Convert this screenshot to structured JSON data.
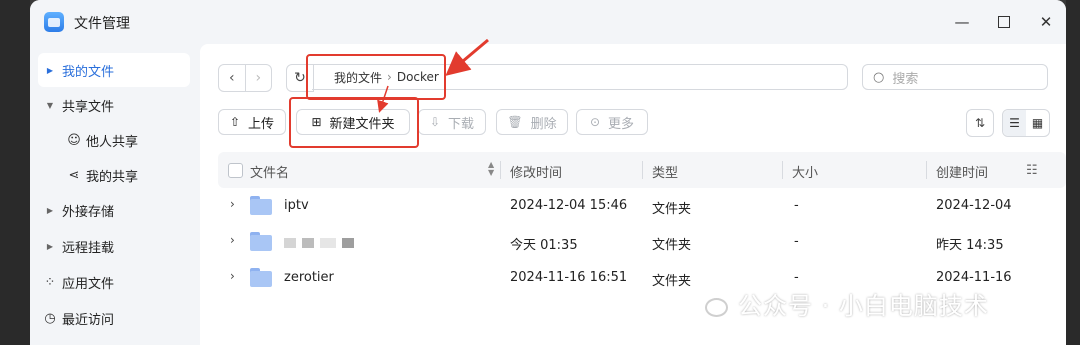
{
  "window": {
    "title": "文件管理"
  },
  "sidebar": {
    "items": [
      {
        "label": "我的文件",
        "active": true
      },
      {
        "label": "共享文件"
      },
      {
        "label": "他人共享"
      },
      {
        "label": "我的共享"
      },
      {
        "label": "外接存储"
      },
      {
        "label": "远程挂载"
      },
      {
        "label": "应用文件"
      },
      {
        "label": "最近访问"
      }
    ]
  },
  "path": {
    "root": "我的文件",
    "current": "Docker"
  },
  "search": {
    "placeholder": "搜索"
  },
  "toolbar": {
    "upload": "上传",
    "new_folder": "新建文件夹",
    "download": "下载",
    "delete": "删除",
    "more": "更多"
  },
  "table": {
    "headers": {
      "name": "文件名",
      "modified": "修改时间",
      "type": "类型",
      "size": "大小",
      "created": "创建时间"
    },
    "rows": [
      {
        "name": "iptv",
        "modified": "2024-12-04 15:46",
        "type": "文件夹",
        "size": "-",
        "created": "2024-12-04"
      },
      {
        "name": "",
        "modified": "今天 01:35",
        "type": "文件夹",
        "size": "-",
        "created": "昨天 14:35"
      },
      {
        "name": "zerotier",
        "modified": "2024-11-16 16:51",
        "type": "文件夹",
        "size": "-",
        "created": "2024-11-16"
      }
    ]
  },
  "watermark": "公众号 · 小白电脑技术",
  "colors": {
    "accent": "#2a6fdb",
    "annotation": "#e23b2e",
    "folder": "#a9c6f5"
  }
}
